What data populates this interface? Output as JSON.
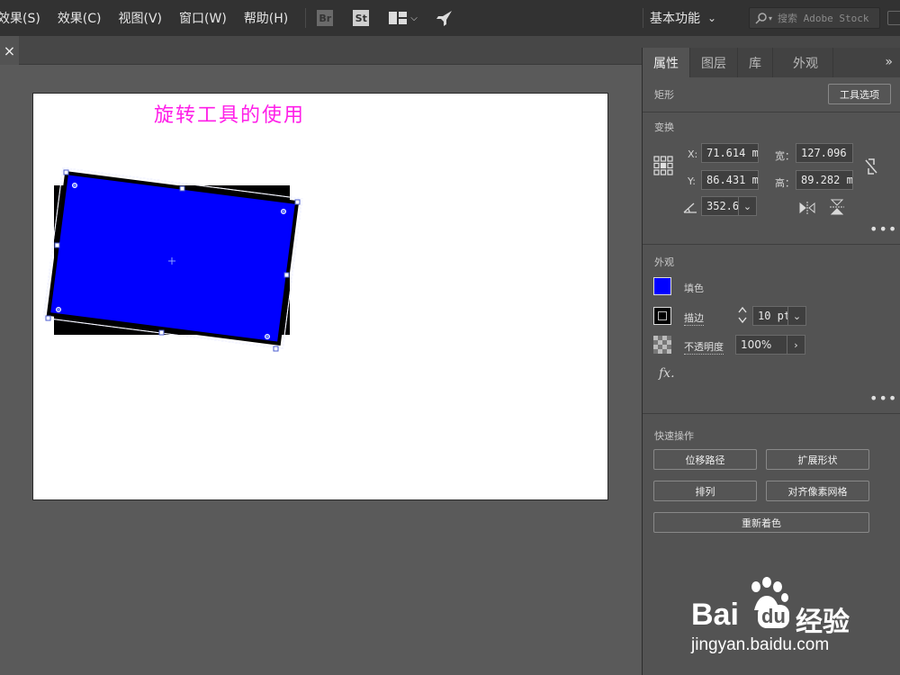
{
  "menubar": {
    "items": [
      "效果(S)",
      "效果(C)",
      "视图(V)",
      "窗口(W)",
      "帮助(H)"
    ],
    "apps": {
      "br": "Br",
      "st": "St"
    },
    "workspace_label": "基本功能",
    "search_placeholder": "搜索 Adobe Stock"
  },
  "tabbar": {
    "close_glyph": "×"
  },
  "artboard": {
    "title": "旋转工具的使用",
    "rect_fill": "#0000ff",
    "shadow_fill": "#000000",
    "rotation_deg": 352.68
  },
  "panel": {
    "tabs": [
      "属性",
      "图层",
      "库",
      "外观"
    ],
    "more_glyph": "»",
    "object_type": "矩形",
    "tool_options_button": "工具选项",
    "transform": {
      "label": "变换",
      "x_label": "X:",
      "x_value": "71.614 m",
      "y_label": "Y:",
      "y_value": "86.431 m",
      "w_label": "宽：",
      "w_value": "127.096 :",
      "h_label": "高：",
      "h_value": "89.282 m",
      "angle_value": "352.6£"
    },
    "appearance": {
      "label": "外观",
      "fill_label": "填色",
      "stroke_label": "描边",
      "stroke_value": "10 pt",
      "opacity_label": "不透明度",
      "opacity_value": "100%",
      "fx_label": "fx."
    },
    "quick_actions": {
      "label": "快速操作",
      "offset_path": "位移路径",
      "expand_shape": "扩展形状",
      "arrange": "排列",
      "align_pixel_grid": "对齐像素网格",
      "recolor": "重新着色"
    },
    "dots": "•••"
  },
  "watermark": {
    "brand": "Bai",
    "brand_du": "du",
    "brand_cn": "经验",
    "url": "jingyan.baidu.com"
  },
  "colors": {
    "menubar_bg": "#323232",
    "canvas_bg": "#5a5a5a",
    "panel_bg": "#535353",
    "title_magenta": "#ff1ee8",
    "shape_blue": "#0000ff"
  }
}
